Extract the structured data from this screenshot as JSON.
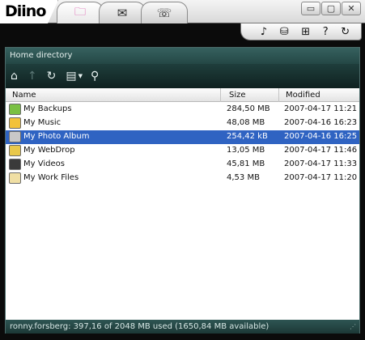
{
  "app": {
    "logo_text": "Diino"
  },
  "tabs": [
    {
      "name": "folder-tab",
      "icon": "folder-icon",
      "glyph": "🗀",
      "active": true
    },
    {
      "name": "mail-tab",
      "icon": "mail-icon",
      "glyph": "✉",
      "active": false
    },
    {
      "name": "phone-tab",
      "icon": "phone-icon",
      "glyph": "☏",
      "active": false
    }
  ],
  "window_controls": {
    "minimize": "▭",
    "maximize": "▢",
    "close": "✕"
  },
  "tools": [
    {
      "icon": "music-note-icon",
      "glyph": "♪"
    },
    {
      "icon": "backup-icon",
      "glyph": "⛁"
    },
    {
      "icon": "add-icon",
      "glyph": "⊞"
    },
    {
      "icon": "help-icon",
      "glyph": "?"
    },
    {
      "icon": "refresh-icon",
      "glyph": "↻"
    }
  ],
  "panel": {
    "title": "Home directory",
    "toolbar": {
      "home": "⌂",
      "up": "↑",
      "refresh": "↻",
      "view": "▤",
      "view_dropdown": "▼",
      "search": "⚲"
    },
    "columns": {
      "name": "Name",
      "size": "Size",
      "modified": "Modified"
    },
    "files": [
      {
        "name": "My Backups",
        "size": "284,50 MB",
        "modified": "2007-04-17 11:21",
        "icon": "backup-folder-icon",
        "color": "#7ac043",
        "selected": false
      },
      {
        "name": "My Music",
        "size": "48,08 MB",
        "modified": "2007-04-16 16:23",
        "icon": "music-folder-icon",
        "color": "#f2c23a",
        "selected": false
      },
      {
        "name": "My Photo Album",
        "size": "254,42 kB",
        "modified": "2007-04-16 16:25",
        "icon": "photo-folder-icon",
        "color": "#c8c8c8",
        "selected": true
      },
      {
        "name": "My WebDrop",
        "size": "13,05 MB",
        "modified": "2007-04-17 11:46",
        "icon": "webdrop-folder-icon",
        "color": "#e9c84a",
        "selected": false
      },
      {
        "name": "My Videos",
        "size": "45,81 MB",
        "modified": "2007-04-17 11:33",
        "icon": "video-folder-icon",
        "color": "#3a3a3a",
        "selected": false
      },
      {
        "name": "My Work Files",
        "size": "4,53 MB",
        "modified": "2007-04-17 11:20",
        "icon": "work-folder-icon",
        "color": "#f0dfa4",
        "selected": false
      }
    ],
    "status": "ronny.forsberg: 397,16 of 2048 MB used (1650,84 MB available)"
  },
  "colors": {
    "accent": "#2f63c2",
    "panel_header": "#2b5250",
    "chrome": "#0b0b0b"
  }
}
